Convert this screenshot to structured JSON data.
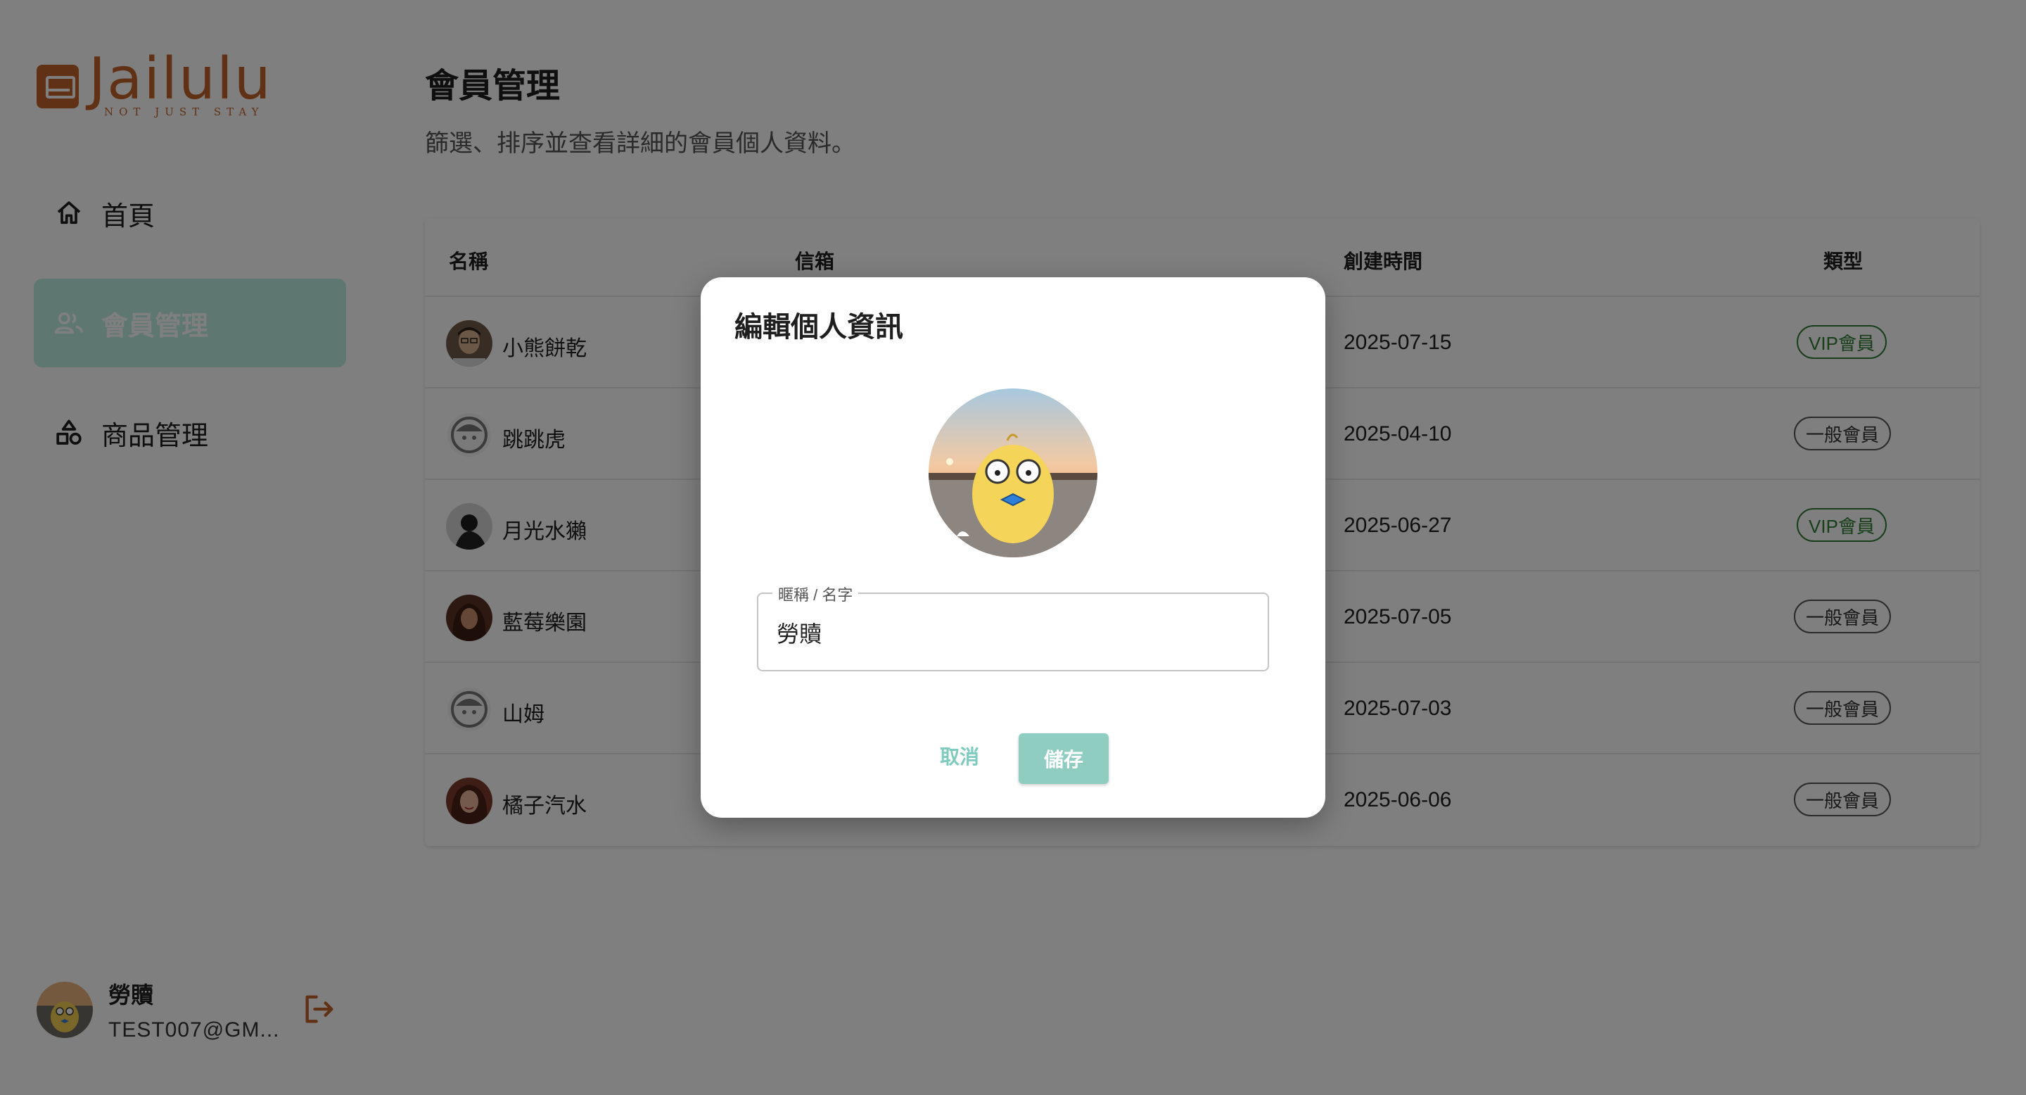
{
  "brand": {
    "name": "Jailulu",
    "tagline": "NOT JUST STAY",
    "color": "#c2632a"
  },
  "sidebar": {
    "items": [
      {
        "label": "首頁",
        "icon": "home-icon",
        "active": false
      },
      {
        "label": "會員管理",
        "icon": "users-icon",
        "active": true
      },
      {
        "label": "商品管理",
        "icon": "shapes-icon",
        "active": false
      }
    ],
    "active_color": "#bdeee3"
  },
  "current_user": {
    "name": "勞贖",
    "email": "TEST007@GM...",
    "logout_icon": "logout-icon"
  },
  "page": {
    "title": "會員管理",
    "subtitle": "篩選、排序並查看詳細的會員個人資料。"
  },
  "table": {
    "headers": {
      "name": "名稱",
      "email": "信箱",
      "created": "創建時間",
      "type": "類型"
    },
    "rows": [
      {
        "name": "小熊餅乾",
        "created": "2025-07-15",
        "type": "VIP會員",
        "vip": true,
        "avatar": "photo"
      },
      {
        "name": "跳跳虎",
        "created": "2025-04-10",
        "type": "一般會員",
        "vip": false,
        "avatar": "default"
      },
      {
        "name": "月光水獺",
        "created": "2025-06-27",
        "type": "VIP會員",
        "vip": true,
        "avatar": "photo"
      },
      {
        "name": "藍莓樂園",
        "created": "2025-07-05",
        "type": "一般會員",
        "vip": false,
        "avatar": "photo"
      },
      {
        "name": "山姆",
        "created": "2025-07-03",
        "type": "一般會員",
        "vip": false,
        "avatar": "default"
      },
      {
        "name": "橘子汽水",
        "created": "2025-06-06",
        "type": "一般會員",
        "vip": false,
        "avatar": "photo"
      }
    ]
  },
  "dialog": {
    "title": "編輯個人資訊",
    "field_label": "暱稱 / 名字",
    "field_value": "勞贖",
    "cancel_label": "取消",
    "save_label": "儲存",
    "accent_color": "#8fcdc1"
  }
}
